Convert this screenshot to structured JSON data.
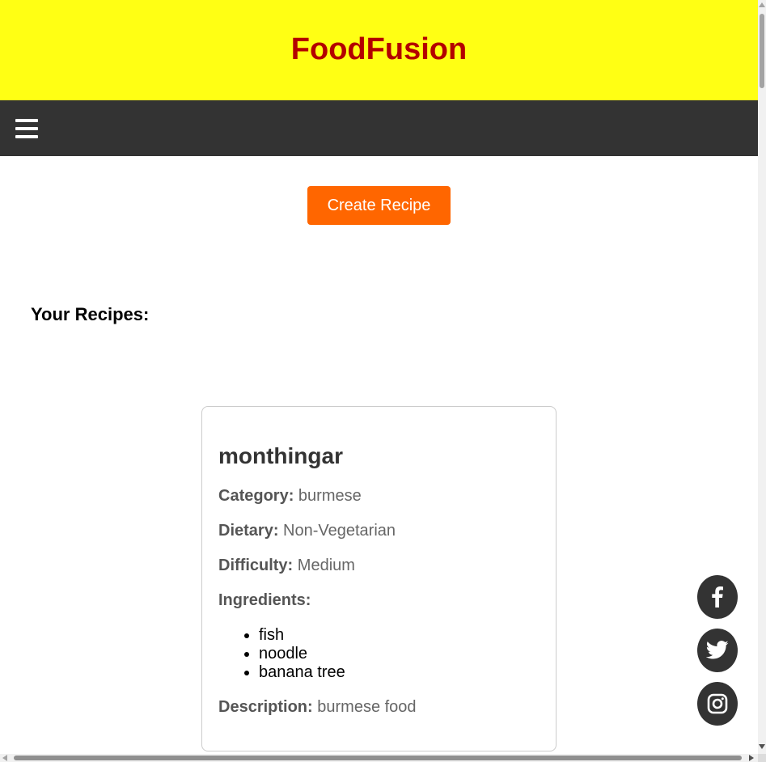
{
  "header": {
    "title": "FoodFusion"
  },
  "nav": {
    "menu_icon": "hamburger-menu-icon"
  },
  "main": {
    "create_button_label": "Create Recipe",
    "section_title": "Your Recipes:"
  },
  "recipe": {
    "name": "monthingar",
    "category_label": "Category:",
    "category": "burmese",
    "dietary_label": "Dietary:",
    "dietary": "Non-Vegetarian",
    "difficulty_label": "Difficulty:",
    "difficulty": "Medium",
    "ingredients_label": "Ingredients:",
    "ingredients": [
      "fish",
      "noodle",
      "banana tree"
    ],
    "description_label": "Description:",
    "description": "burmese food"
  },
  "social": [
    {
      "icon": "facebook-icon"
    },
    {
      "icon": "twitter-icon"
    },
    {
      "icon": "instagram-icon"
    }
  ],
  "colors": {
    "header_bg": "#ffff14",
    "title": "#b30000",
    "nav_bg": "#333333",
    "accent": "#ff6600"
  }
}
